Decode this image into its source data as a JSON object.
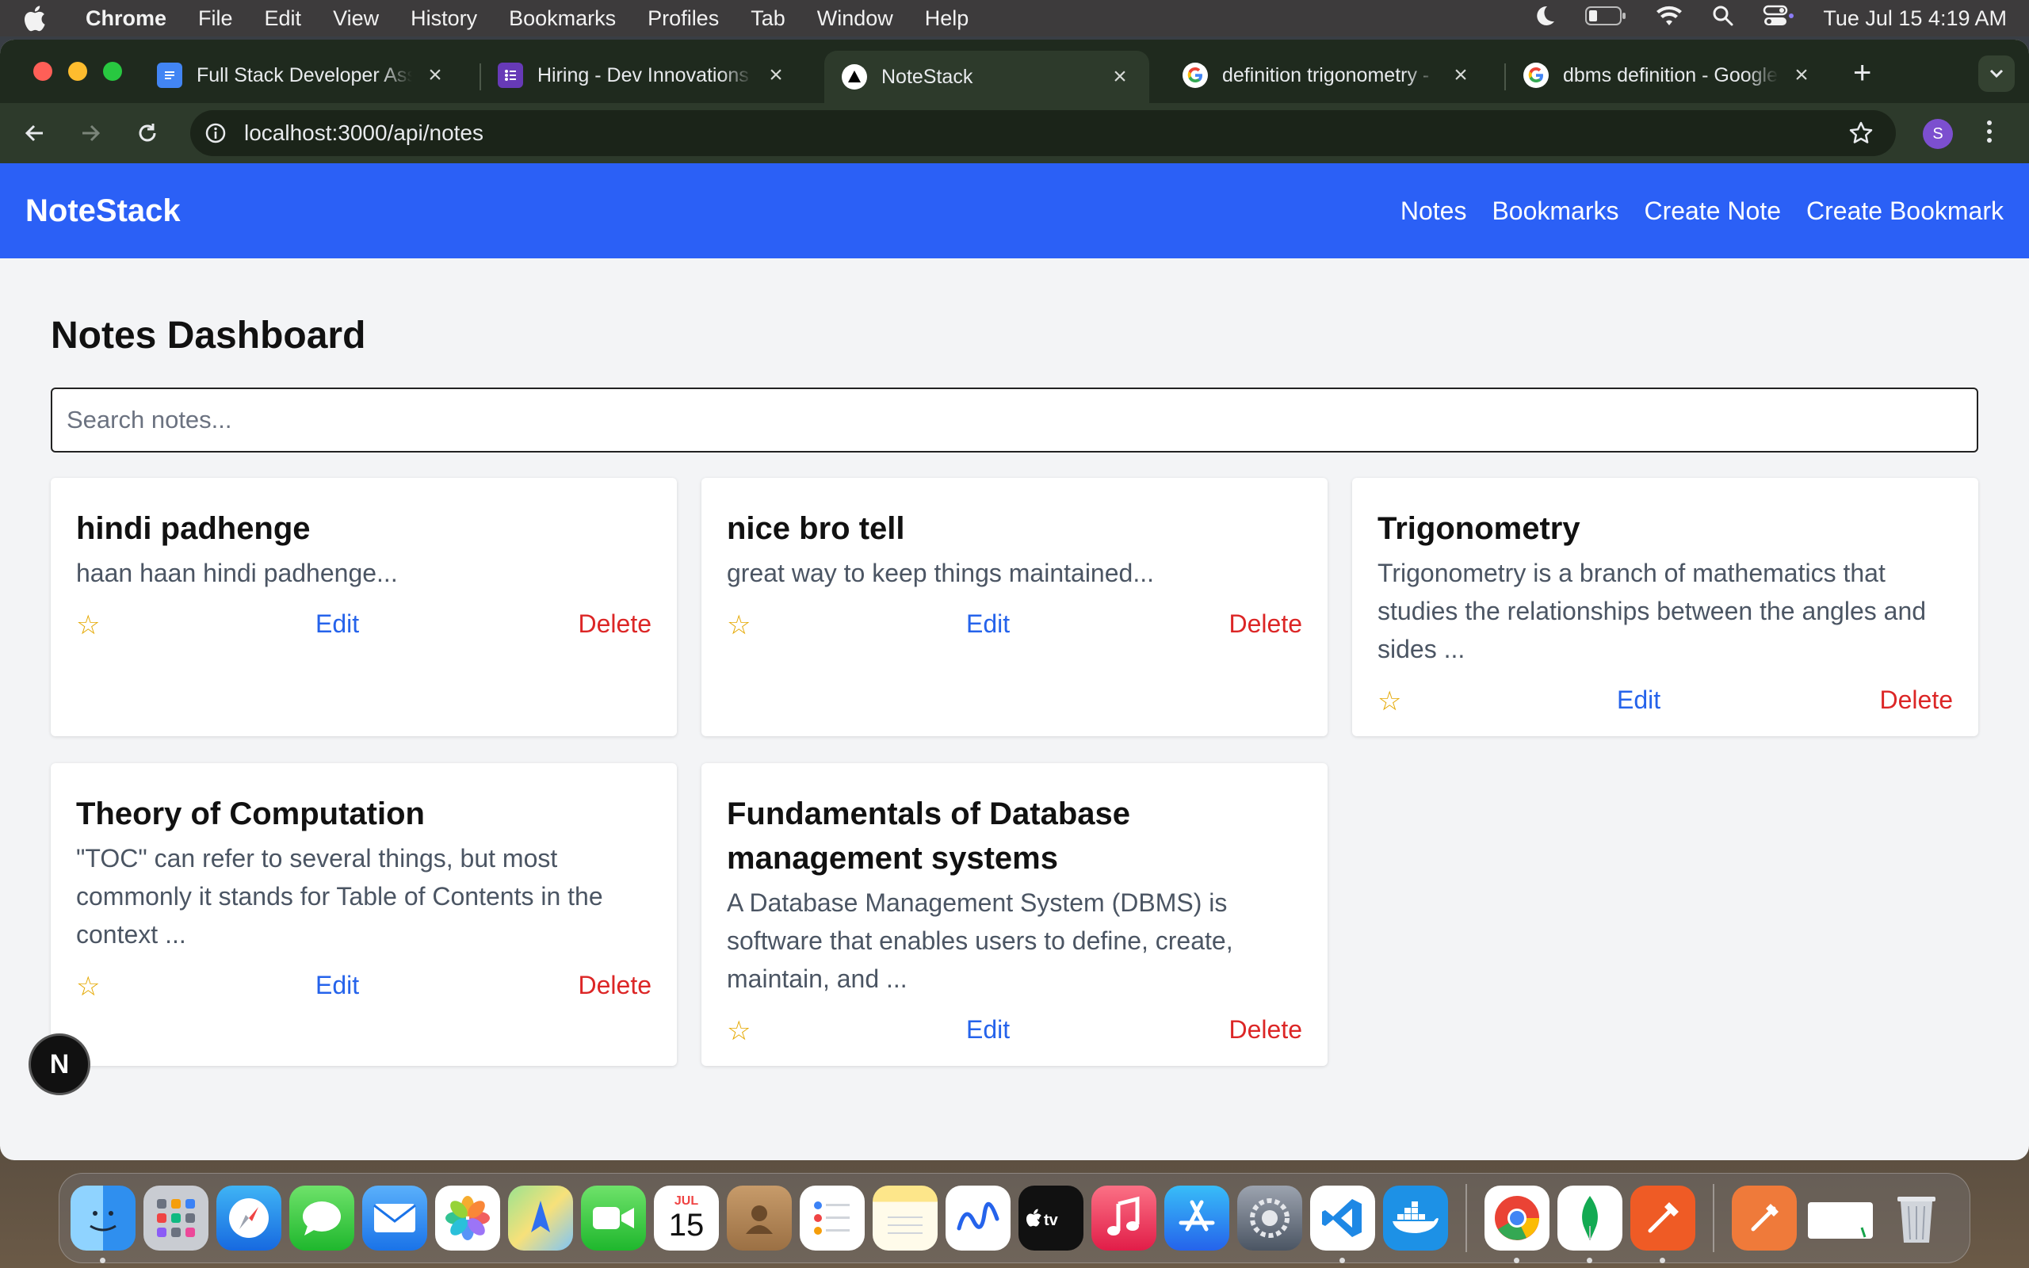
{
  "menubar": {
    "app_name": "Chrome",
    "items": [
      "File",
      "Edit",
      "View",
      "History",
      "Bookmarks",
      "Profiles",
      "Tab",
      "Window",
      "Help"
    ],
    "clock": "Tue Jul 15  4:19 AM"
  },
  "browser": {
    "tabs": [
      {
        "title": "Full Stack Developer Assi",
        "icon": "google-docs-icon",
        "color": "#4285f4"
      },
      {
        "title": "Hiring - Dev Innovations L",
        "icon": "google-forms-icon",
        "color": "#673ab7"
      },
      {
        "title": "NoteStack",
        "icon": "nextjs-icon",
        "color": "#000000"
      },
      {
        "title": "definition trigonometry - ",
        "icon": "google-icon",
        "color": "#ffffff"
      },
      {
        "title": "dbms definition - Google ",
        "icon": "google-icon",
        "color": "#ffffff"
      }
    ],
    "active_tab": 2,
    "url": "localhost:3000/api/notes",
    "profile_initial": "S"
  },
  "app": {
    "brand": "NoteStack",
    "nav": [
      "Notes",
      "Bookmarks",
      "Create Note",
      "Create Bookmark"
    ],
    "page_title": "Notes Dashboard",
    "search_placeholder": "Search notes...",
    "notes": [
      {
        "title": "hindi padhenge",
        "excerpt": "haan haan hindi padhenge...",
        "favorite": "☆",
        "edit": "Edit",
        "delete": "Delete"
      },
      {
        "title": "nice bro tell",
        "excerpt": "great way to keep things maintained...",
        "favorite": "☆",
        "edit": "Edit",
        "delete": "Delete"
      },
      {
        "title": "Trigonometry",
        "excerpt": "Trigonometry is a branch of mathematics that studies the relationships between the angles and sides ...",
        "favorite": "☆",
        "edit": "Edit",
        "delete": "Delete"
      },
      {
        "title": "Theory of Computation",
        "excerpt": "\"TOC\" can refer to several things, but most commonly it stands for Table of Contents in the context ...",
        "favorite": "☆",
        "edit": "Edit",
        "delete": "Delete"
      },
      {
        "title": "Fundamentals of Database management systems",
        "excerpt": "A Database Management System (DBMS) is software that enables users to define, create, maintain, and ...",
        "favorite": "☆",
        "edit": "Edit",
        "delete": "Delete"
      }
    ],
    "dev_badge": "N"
  },
  "colors": {
    "accent": "#2b60f6",
    "edit": "#2563eb",
    "delete": "#dc2626",
    "star": "#e5a800"
  },
  "dock": {
    "calendar_month": "JUL",
    "calendar_day": "15",
    "apps": [
      "finder-icon",
      "launchpad-icon",
      "safari-icon",
      "messages-icon",
      "mail-icon",
      "photos-icon",
      "maps-icon",
      "facetime-icon",
      "calendar-icon",
      "contacts-icon",
      "reminders-icon",
      "notes-icon",
      "freeform-icon",
      "appletv-icon",
      "music-icon",
      "appstore-icon",
      "settings-icon",
      "vscode-icon",
      "docker-icon",
      "chrome-icon",
      "mongodb-icon",
      "postman-icon",
      "downloads-icon",
      "folder-icon",
      "trash-icon"
    ]
  }
}
